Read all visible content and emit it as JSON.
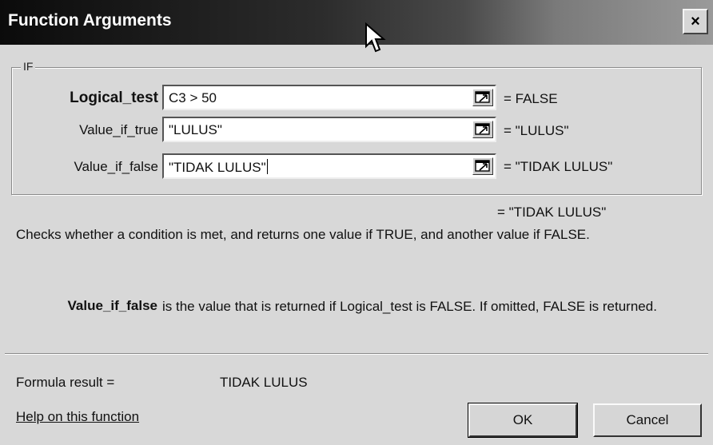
{
  "window": {
    "title": "Function Arguments",
    "close_label": "×"
  },
  "function_group": {
    "name": "IF"
  },
  "arguments": [
    {
      "label": "Logical_test",
      "value": "C3 > 50",
      "result": "= FALSE"
    },
    {
      "label": "Value_if_true",
      "value": "\"LULUS\"",
      "result": "= \"LULUS\""
    },
    {
      "label": "Value_if_false",
      "value": "\"TIDAK LULUS\"",
      "result": "= \"TIDAK LULUS\""
    }
  ],
  "overall_result": "= \"TIDAK LULUS\"",
  "description": "Checks whether a condition is met, and returns one value if TRUE, and another value if FALSE.",
  "argument_help": {
    "name": "Value_if_false",
    "text": "is the value that is returned if Logical_test is FALSE. If omitted, FALSE is returned."
  },
  "formula_result": {
    "label": "Formula result =",
    "value": "TIDAK LULUS"
  },
  "help_link": "Help on this function",
  "buttons": {
    "ok": "OK",
    "cancel": "Cancel"
  },
  "icons": {
    "collapse": "collapse-dialog-icon",
    "cursor": "mouse-pointer-icon",
    "close": "close-icon"
  }
}
